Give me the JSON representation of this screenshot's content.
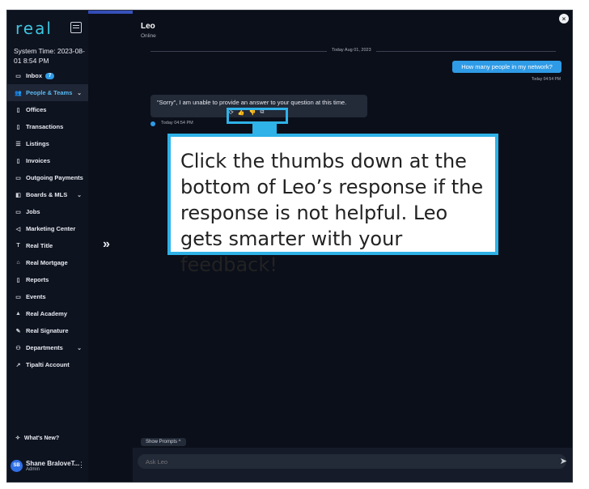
{
  "sidebar": {
    "logo": "real",
    "system_time": "System Time: 2023-08-01 8:54 PM",
    "nav": [
      {
        "label": "Inbox",
        "icon": "inbox-icon",
        "glyph": "▭",
        "badge": "7"
      },
      {
        "label": "People & Teams",
        "icon": "people-icon",
        "glyph": "👥",
        "active": true,
        "chevron": "⌄"
      },
      {
        "label": "Offices",
        "icon": "office-icon",
        "glyph": "▯"
      },
      {
        "label": "Transactions",
        "icon": "transactions-icon",
        "glyph": "▯"
      },
      {
        "label": "Listings",
        "icon": "list-icon",
        "glyph": "☰"
      },
      {
        "label": "Invoices",
        "icon": "invoice-icon",
        "glyph": "▯"
      },
      {
        "label": "Outgoing Payments",
        "icon": "payment-icon",
        "glyph": "▭"
      },
      {
        "label": "Boards & MLS",
        "icon": "boards-icon",
        "glyph": "◧",
        "chevron": "⌄"
      },
      {
        "label": "Jobs",
        "icon": "jobs-icon",
        "glyph": "▭"
      },
      {
        "label": "Marketing Center",
        "icon": "megaphone-icon",
        "glyph": "◁"
      },
      {
        "label": "Real Title",
        "icon": "title-icon",
        "glyph": "T"
      },
      {
        "label": "Real Mortgage",
        "icon": "bank-icon",
        "glyph": "⌂"
      },
      {
        "label": "Reports",
        "icon": "reports-icon",
        "glyph": "▯"
      },
      {
        "label": "Events",
        "icon": "events-icon",
        "glyph": "▭"
      },
      {
        "label": "Real Academy",
        "icon": "academy-icon",
        "glyph": "▲"
      },
      {
        "label": "Real Signature",
        "icon": "signature-icon",
        "glyph": "✎"
      },
      {
        "label": "Departments",
        "icon": "departments-icon",
        "glyph": "⚇",
        "chevron": "⌄"
      },
      {
        "label": "Tipalti Account",
        "icon": "external-link-icon",
        "glyph": "↗"
      }
    ],
    "whats_new": "What's New?",
    "user": {
      "initials": "SB",
      "name": "Shane BraloveT...",
      "role": "Admin"
    }
  },
  "chat": {
    "title": "Leo",
    "status": "Online",
    "date_divider": "Today Aug 01, 2023",
    "user_message": "How many people in my network?",
    "user_time": "Today 04:54 PM",
    "bot_message": "\"Sorry\", I am unable to provide an answer to your question at this time.",
    "bot_time": "Today 04:54 PM",
    "show_prompts": "Show Prompts ^",
    "input_placeholder": "Ask Leo"
  },
  "callout": {
    "text": "Click the thumbs down at the bottom of Leo’s response if the response is not helpful. Leo gets smarter with your feedback!"
  },
  "colors": {
    "accent": "#2eb2e8",
    "bubble": "#2f9be6",
    "background": "#0b0f1a"
  }
}
